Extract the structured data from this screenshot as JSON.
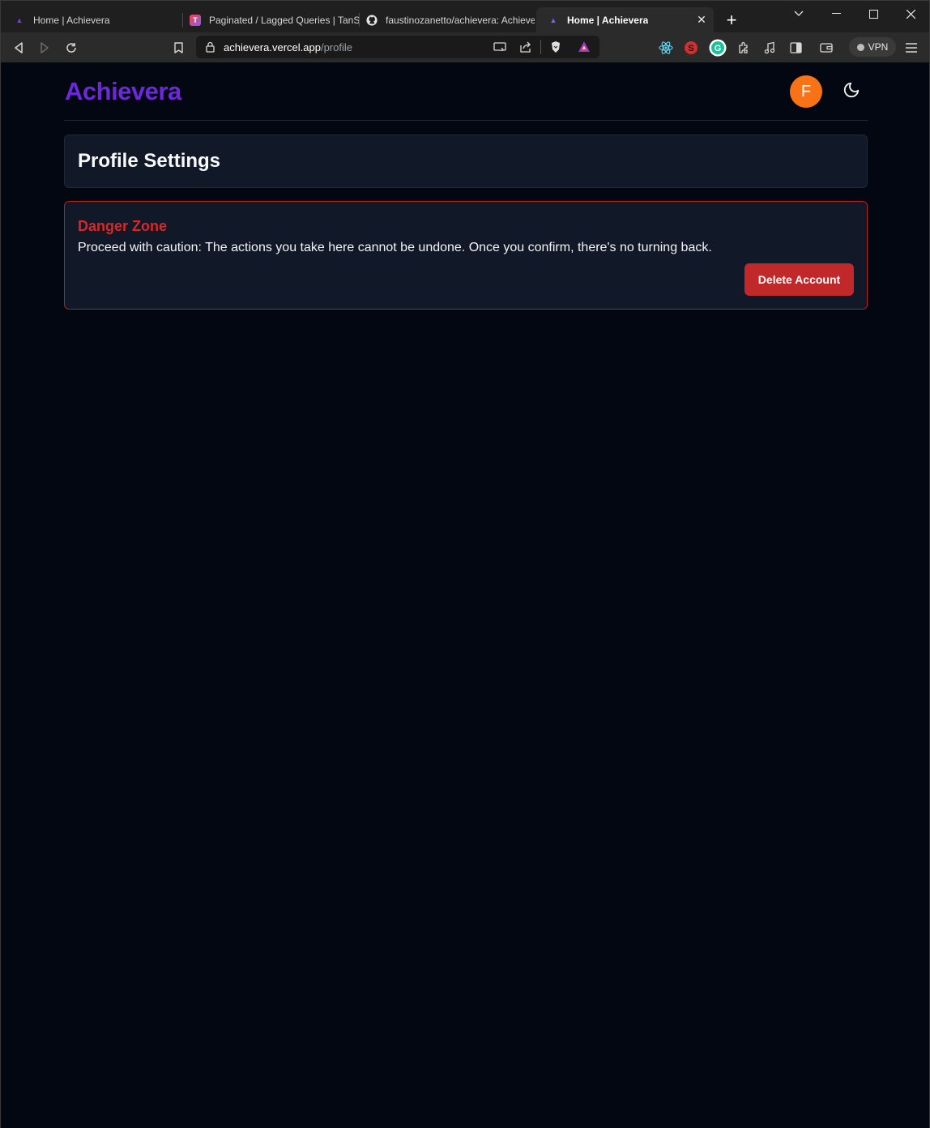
{
  "browser": {
    "tabs": [
      {
        "title": "Home | Achievera",
        "favicon": "achievera-logo-icon"
      },
      {
        "title": "Paginated / Lagged Queries | TanSt",
        "favicon": "tanstack-icon"
      },
      {
        "title": "faustinozanetto/achievera: Achieve",
        "favicon": "github-icon"
      },
      {
        "title": "Home | Achievera",
        "favicon": "achievera-logo-icon"
      }
    ],
    "new_tab_label": "+",
    "address": {
      "host": "achievera.vercel.app",
      "path": "/profile"
    },
    "vpn_label": "VPN"
  },
  "app": {
    "brand": "Achievera",
    "avatar_initial": "F",
    "colors": {
      "brand": "#6d28d9",
      "avatar": "#f97316",
      "danger": "#dc2626",
      "danger_button": "#c0282a"
    }
  },
  "profile": {
    "title": "Profile Settings",
    "danger_zone": {
      "title": "Danger Zone",
      "description": "Proceed with caution: The actions you take here cannot be undone. Once you confirm, there's no turning back.",
      "delete_label": "Delete Account"
    }
  }
}
